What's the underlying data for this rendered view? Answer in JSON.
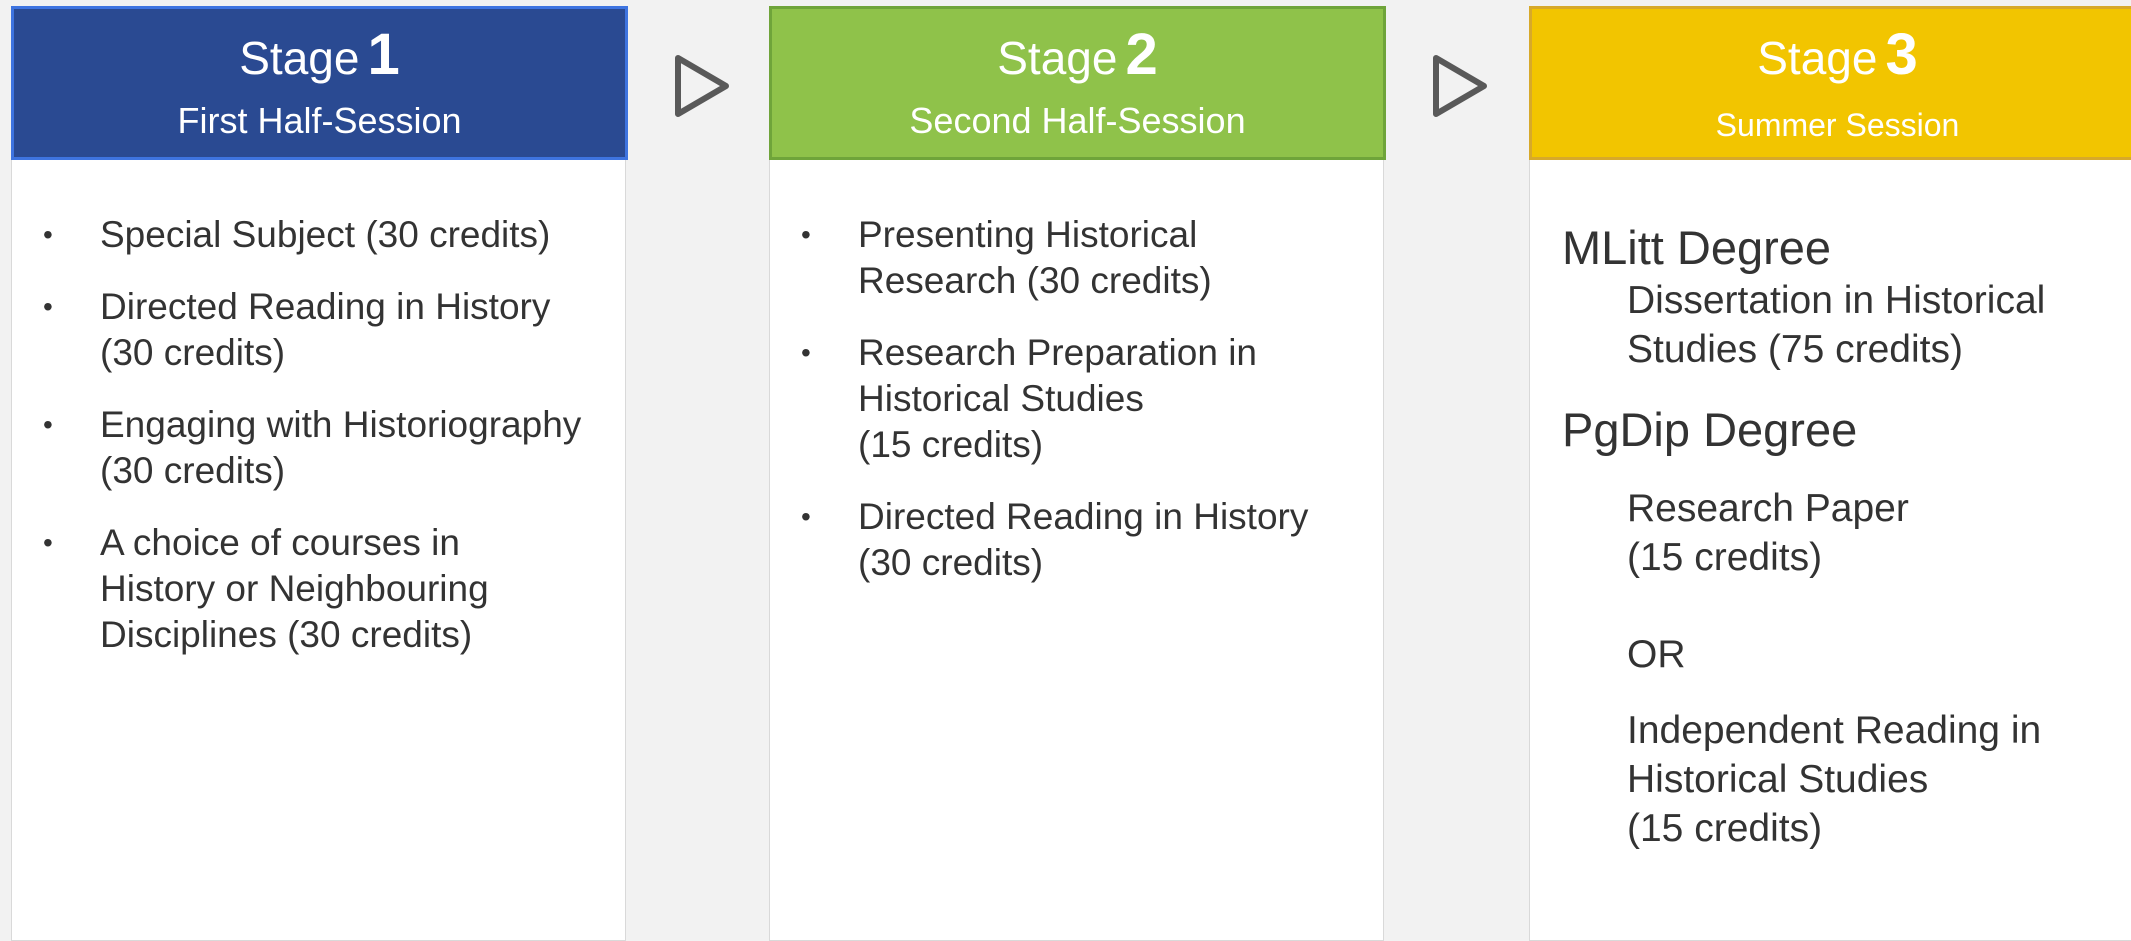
{
  "stages": [
    {
      "word": "Stage",
      "number": "1",
      "subtitle": "First Half-Session",
      "items": [
        "Special Subject (30 credits)",
        "Directed Reading in History\n(30 credits)",
        "Engaging with Historiography\n(30 credits)",
        "A choice of courses in\nHistory or Neighbouring\nDisciplines (30 credits)"
      ]
    },
    {
      "word": "Stage",
      "number": "2",
      "subtitle": "Second Half-Session",
      "items": [
        "Presenting Historical\nResearch (30 credits)",
        "Research Preparation in\nHistorical Studies\n(15 credits)",
        "Directed Reading in History\n(30 credits)"
      ]
    },
    {
      "word": "Stage",
      "number": "3",
      "subtitle": "Summer Session",
      "mlitt": {
        "heading": "MLitt Degree",
        "item": "Dissertation in Historical\nStudies (75 credits)"
      },
      "pgdip": {
        "heading": "PgDip Degree",
        "option1": "Research Paper\n(15 credits)",
        "or": "OR",
        "option2": "Independent Reading in\nHistorical Studies\n(15 credits)"
      }
    }
  ],
  "bullet": "•",
  "colors": {
    "stage1": "#2a4a92",
    "stage2": "#8fc24a",
    "stage3": "#f2c500",
    "arrow": "#595959"
  },
  "icons": {
    "flow_arrow": "play-triangle-outline-icon"
  }
}
